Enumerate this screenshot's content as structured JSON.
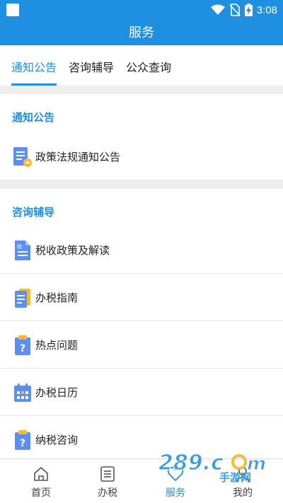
{
  "status_bar": {
    "time": "3:08",
    "icons": [
      "app-notification-icon",
      "wifi-icon",
      "no-sim-icon",
      "battery-charging-icon"
    ]
  },
  "app_bar": {
    "title": "服务"
  },
  "tabs": [
    {
      "label": "通知公告",
      "active": true
    },
    {
      "label": "咨询辅导",
      "active": false
    },
    {
      "label": "公众查询",
      "active": false
    }
  ],
  "sections": {
    "notice": {
      "header": "通知公告",
      "items": [
        {
          "label": "政策法规通知公告",
          "icon": "policy-notice-icon"
        }
      ]
    },
    "consult": {
      "header": "咨询辅导",
      "items": [
        {
          "label": "税收政策及解读",
          "icon": "tax-document-icon"
        },
        {
          "label": "办税指南",
          "icon": "guide-book-icon"
        },
        {
          "label": "热点问题",
          "icon": "question-clipboard-icon"
        },
        {
          "label": "办税日历",
          "icon": "calendar-icon"
        },
        {
          "label": "纳税咨询",
          "icon": "question-clipboard-icon"
        }
      ]
    }
  },
  "bottom_nav": [
    {
      "label": "首页",
      "icon": "home-icon",
      "active": false
    },
    {
      "label": "办税",
      "icon": "list-icon",
      "active": false
    },
    {
      "label": "服务",
      "icon": "heart-icon",
      "active": true
    },
    {
      "label": "我的",
      "icon": "person-icon",
      "active": false
    }
  ],
  "colors": {
    "primary": "#1e8fe1",
    "icon_blue": "#5b8ff2",
    "icon_yellow": "#f6b93b"
  },
  "watermark": {
    "text": "289.com",
    "subtext": "手游网"
  }
}
